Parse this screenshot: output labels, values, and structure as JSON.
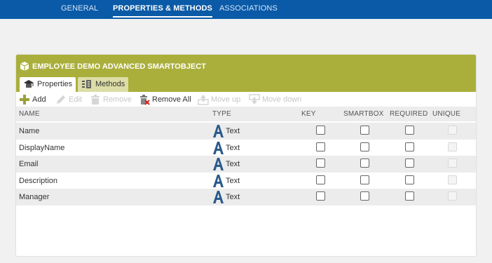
{
  "top_nav": {
    "tabs": [
      {
        "label": "GENERAL",
        "active": false
      },
      {
        "label": "PROPERTIES & METHODS",
        "active": true
      },
      {
        "label": "ASSOCIATIONS",
        "active": false
      }
    ],
    "bar_color": "#0a5aa7"
  },
  "panel": {
    "title": "EMPLOYEE DEMO ADVANCED SMARTOBJECT",
    "header_color": "#aaaf3b",
    "tabs": [
      {
        "label": "Properties",
        "active": true,
        "icon": "properties-icon"
      },
      {
        "label": "Methods",
        "active": false,
        "icon": "methods-icon"
      }
    ]
  },
  "toolbar": {
    "add": {
      "label": "Add",
      "enabled": true,
      "icon": "plus-icon"
    },
    "edit": {
      "label": "Edit",
      "enabled": false,
      "icon": "pencil-icon"
    },
    "remove": {
      "label": "Remove",
      "enabled": false,
      "icon": "trash-icon"
    },
    "remove_all": {
      "label": "Remove All",
      "enabled": true,
      "icon": "trash-x-icon"
    },
    "move_up": {
      "label": "Move up",
      "enabled": false,
      "icon": "arrow-up-icon"
    },
    "move_down": {
      "label": "Move down",
      "enabled": false,
      "icon": "arrow-down-icon"
    }
  },
  "table": {
    "columns": [
      "NAME",
      "TYPE",
      "KEY",
      "SMARTBOX",
      "REQUIRED",
      "UNIQUE"
    ],
    "rows": [
      {
        "name": "Name",
        "type": "Text",
        "key": false,
        "smartbox": false,
        "required": false,
        "unique": false
      },
      {
        "name": "DisplayName",
        "type": "Text",
        "key": false,
        "smartbox": false,
        "required": false,
        "unique": false
      },
      {
        "name": "Email",
        "type": "Text",
        "key": false,
        "smartbox": false,
        "required": false,
        "unique": false
      },
      {
        "name": "Description",
        "type": "Text",
        "key": false,
        "smartbox": false,
        "required": false,
        "unique": false
      },
      {
        "name": "Manager",
        "type": "Text",
        "key": false,
        "smartbox": false,
        "required": false,
        "unique": false
      }
    ]
  }
}
